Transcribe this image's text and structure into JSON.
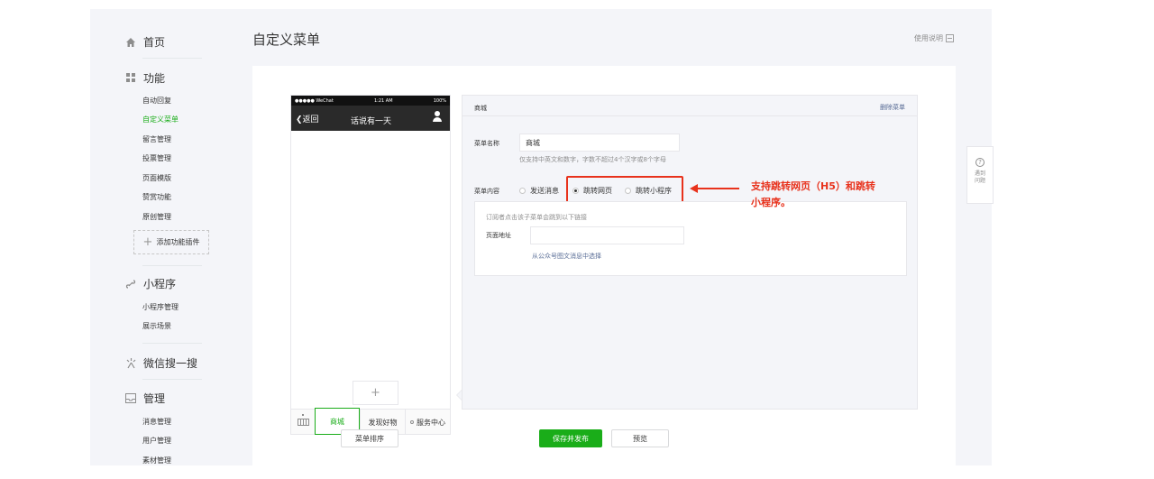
{
  "sidebar": {
    "home": {
      "icon": "home-icon",
      "label": "首页"
    },
    "function": {
      "icon": "grid-icon",
      "label": "功能",
      "items": [
        "自动回复",
        "自定义菜单",
        "留言管理",
        "投票管理",
        "页面模版",
        "赞赏功能",
        "原创管理"
      ],
      "active_item": "自定义菜单",
      "add_plugin": "添加功能插件"
    },
    "miniprogram": {
      "icon": "link-icon",
      "label": "小程序",
      "items": [
        "小程序管理",
        "展示场景"
      ]
    },
    "search": {
      "icon": "sparkle-icon",
      "label": "微信搜一搜"
    },
    "manage": {
      "icon": "inbox-icon",
      "label": "管理",
      "items": [
        "消息管理",
        "用户管理",
        "素材管理"
      ]
    }
  },
  "header": {
    "title": "自定义菜单",
    "help": "使用说明"
  },
  "phone": {
    "status_left": "●●●●● WeChat",
    "status_time": "1:21 AM",
    "status_right": "100%",
    "back": "返回",
    "chat_title": "话说有一天",
    "add_symbol": "+",
    "menu_items": [
      "商城",
      "发现好物",
      "服务中心"
    ]
  },
  "editor": {
    "menu_name": "商城",
    "delete": "删除菜单",
    "name_label": "菜单名称",
    "name_value": "商城",
    "name_hint": "仅支持中英文和数字，字数不超过4个汉字或8个字母",
    "content_label": "菜单内容",
    "options": [
      "发送消息",
      "跳转网页",
      "跳转小程序"
    ],
    "selected_option": "跳转网页",
    "panel_hint": "订阅者点击该子菜单会跳到以下链接",
    "page_label": "页面地址",
    "url_value": "",
    "select_link": "从公众号图文消息中选择"
  },
  "buttons": {
    "sort": "菜单排序",
    "save": "保存并发布",
    "preview": "预览"
  },
  "annotation": {
    "line1": "支持跳转网页（H5）和跳转",
    "line2": "小程序。",
    "color": "#e8321c"
  },
  "float_help": {
    "symbol": "?",
    "text": "遇到问题"
  },
  "colors": {
    "accent": "#1aad19",
    "link": "#576b95"
  }
}
